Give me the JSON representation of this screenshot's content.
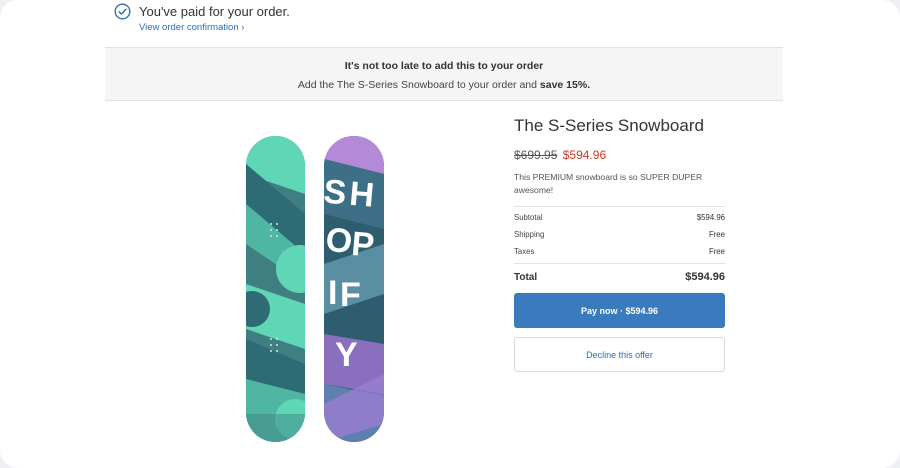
{
  "confirmation": {
    "paid_text": "You've paid for your order.",
    "view_link": "View order confirmation ›"
  },
  "banner": {
    "title": "It's not too late to add this to your order",
    "sub_prefix": "Add the The S-Series Snowboard to your order and ",
    "sub_bold": "save 15%."
  },
  "product": {
    "title": "The S-Series Snowboard",
    "original_price": "$699.95",
    "sale_price": "$594.96",
    "description": "This PREMIUM snowboard is so SUPER DUPER awesome!",
    "board_graphic_text": "SHOPIFY"
  },
  "summary": {
    "rows": [
      {
        "label": "Subtotal",
        "value": "$594.96"
      },
      {
        "label": "Shipping",
        "value": "Free"
      },
      {
        "label": "Taxes",
        "value": "Free"
      }
    ],
    "total_label": "Total",
    "total_value": "$594.96"
  },
  "actions": {
    "pay_label": "Pay now · $594.96",
    "decline_label": "Decline this offer"
  },
  "colors": {
    "accent": "#3a7bbf",
    "link": "#2a6ebb",
    "sale": "#d0361f",
    "board_teal": "#5fd6b5",
    "board_purple": "#9a7ed0"
  }
}
